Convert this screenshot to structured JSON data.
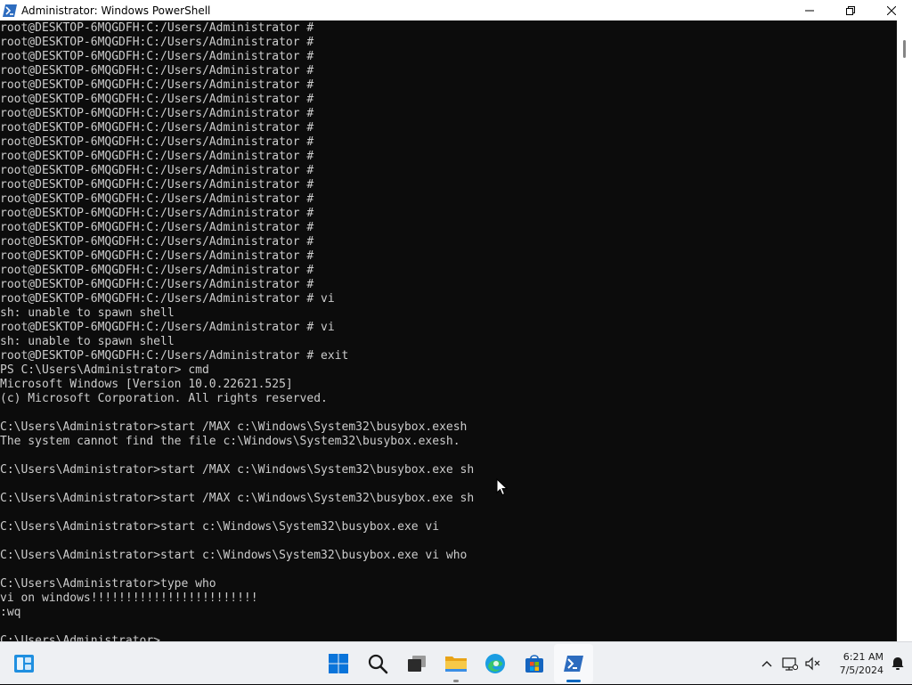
{
  "window": {
    "title": "Administrator: Windows PowerShell",
    "icon": "powershell-icon",
    "controls": [
      "minimize-icon",
      "maximize-icon",
      "close-icon"
    ]
  },
  "console": {
    "background": "#0c0c0c",
    "foreground": "#cccccc",
    "lines": [
      "root@DESKTOP-6MQGDFH:C:/Users/Administrator #",
      "root@DESKTOP-6MQGDFH:C:/Users/Administrator #",
      "root@DESKTOP-6MQGDFH:C:/Users/Administrator #",
      "root@DESKTOP-6MQGDFH:C:/Users/Administrator #",
      "root@DESKTOP-6MQGDFH:C:/Users/Administrator #",
      "root@DESKTOP-6MQGDFH:C:/Users/Administrator #",
      "root@DESKTOP-6MQGDFH:C:/Users/Administrator #",
      "root@DESKTOP-6MQGDFH:C:/Users/Administrator #",
      "root@DESKTOP-6MQGDFH:C:/Users/Administrator #",
      "root@DESKTOP-6MQGDFH:C:/Users/Administrator #",
      "root@DESKTOP-6MQGDFH:C:/Users/Administrator #",
      "root@DESKTOP-6MQGDFH:C:/Users/Administrator #",
      "root@DESKTOP-6MQGDFH:C:/Users/Administrator #",
      "root@DESKTOP-6MQGDFH:C:/Users/Administrator #",
      "root@DESKTOP-6MQGDFH:C:/Users/Administrator #",
      "root@DESKTOP-6MQGDFH:C:/Users/Administrator #",
      "root@DESKTOP-6MQGDFH:C:/Users/Administrator #",
      "root@DESKTOP-6MQGDFH:C:/Users/Administrator #",
      "root@DESKTOP-6MQGDFH:C:/Users/Administrator #",
      "root@DESKTOP-6MQGDFH:C:/Users/Administrator # vi",
      "sh: unable to spawn shell",
      "root@DESKTOP-6MQGDFH:C:/Users/Administrator # vi",
      "sh: unable to spawn shell",
      "root@DESKTOP-6MQGDFH:C:/Users/Administrator # exit",
      "PS C:\\Users\\Administrator> cmd",
      "Microsoft Windows [Version 10.0.22621.525]",
      "(c) Microsoft Corporation. All rights reserved.",
      "",
      "C:\\Users\\Administrator>start /MAX c:\\Windows\\System32\\busybox.exesh",
      "The system cannot find the file c:\\Windows\\System32\\busybox.exesh.",
      "",
      "C:\\Users\\Administrator>start /MAX c:\\Windows\\System32\\busybox.exe sh",
      "",
      "C:\\Users\\Administrator>start /MAX c:\\Windows\\System32\\busybox.exe sh",
      "",
      "C:\\Users\\Administrator>start c:\\Windows\\System32\\busybox.exe vi",
      "",
      "C:\\Users\\Administrator>start c:\\Windows\\System32\\busybox.exe vi who",
      "",
      "C:\\Users\\Administrator>type who",
      "vi on windows!!!!!!!!!!!!!!!!!!!!!!!!",
      ":wq",
      ""
    ],
    "prompt": "C:\\Users\\Administrator>"
  },
  "taskbar": {
    "widgets_icon": "widgets-icon",
    "apps": [
      {
        "name": "start",
        "icon": "windows-start-icon",
        "active": false,
        "running": false
      },
      {
        "name": "search",
        "icon": "search-icon",
        "active": false,
        "running": false
      },
      {
        "name": "task-view",
        "icon": "task-view-icon",
        "active": false,
        "running": false
      },
      {
        "name": "file-explorer",
        "icon": "folder-icon",
        "active": false,
        "running": true
      },
      {
        "name": "edge",
        "icon": "edge-icon",
        "active": false,
        "running": false
      },
      {
        "name": "store",
        "icon": "store-icon",
        "active": false,
        "running": false
      },
      {
        "name": "powershell",
        "icon": "powershell-icon",
        "active": true,
        "running": true
      }
    ],
    "tray": {
      "icons": [
        "chevron-up-icon",
        "network-icon",
        "volume-muted-icon"
      ],
      "time": "6:21 AM",
      "date": "7/5/2024",
      "notification_icon": "notification-icon"
    },
    "accent": "#0067c0"
  }
}
